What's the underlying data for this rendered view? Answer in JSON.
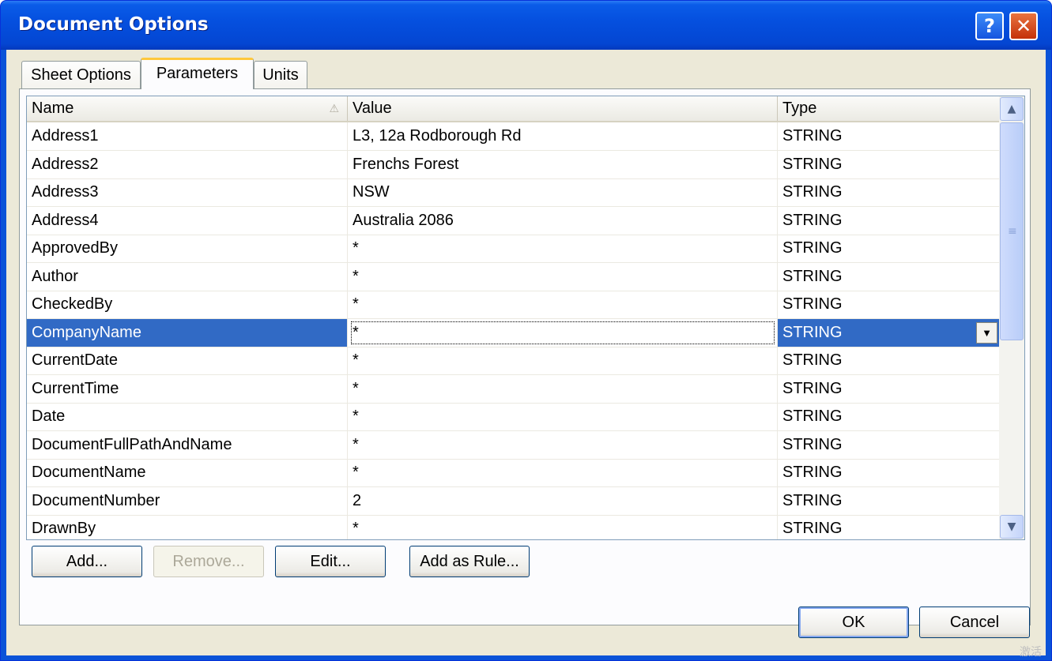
{
  "window": {
    "title": "Document Options",
    "help_glyph": "?",
    "close_glyph": "✕"
  },
  "tabs": [
    {
      "label": "Sheet Options",
      "selected": false
    },
    {
      "label": "Parameters",
      "selected": true
    },
    {
      "label": "Units",
      "selected": false
    }
  ],
  "table": {
    "columns": {
      "name": "Name",
      "value": "Value",
      "type": "Type"
    },
    "sort_indicator": "⚠",
    "rows": [
      {
        "name": "Address1",
        "value": "L3, 12a Rodborough Rd",
        "type": "STRING"
      },
      {
        "name": "Address2",
        "value": "Frenchs Forest",
        "type": "STRING"
      },
      {
        "name": "Address3",
        "value": "NSW",
        "type": "STRING"
      },
      {
        "name": "Address4",
        "value": "Australia 2086",
        "type": "STRING"
      },
      {
        "name": "ApprovedBy",
        "value": "*",
        "type": "STRING"
      },
      {
        "name": "Author",
        "value": "*",
        "type": "STRING"
      },
      {
        "name": "CheckedBy",
        "value": "*",
        "type": "STRING"
      },
      {
        "name": "CompanyName",
        "value": "*",
        "type": "STRING"
      },
      {
        "name": "CurrentDate",
        "value": "*",
        "type": "STRING"
      },
      {
        "name": "CurrentTime",
        "value": "*",
        "type": "STRING"
      },
      {
        "name": "Date",
        "value": "*",
        "type": "STRING"
      },
      {
        "name": "DocumentFullPathAndName",
        "value": "*",
        "type": "STRING"
      },
      {
        "name": "DocumentName",
        "value": "*",
        "type": "STRING"
      },
      {
        "name": "DocumentNumber",
        "value": "2",
        "type": "STRING"
      },
      {
        "name": "DrawnBy",
        "value": "*",
        "type": "STRING"
      }
    ]
  },
  "buttons": {
    "add": "Add...",
    "remove": "Remove...",
    "edit": "Edit...",
    "add_as_rule": "Add as Rule...",
    "ok": "OK",
    "cancel": "Cancel"
  },
  "scrollbar": {
    "up_glyph": "▲",
    "down_glyph": "▼",
    "grip_glyph": "≡"
  },
  "watermark": "激活"
}
